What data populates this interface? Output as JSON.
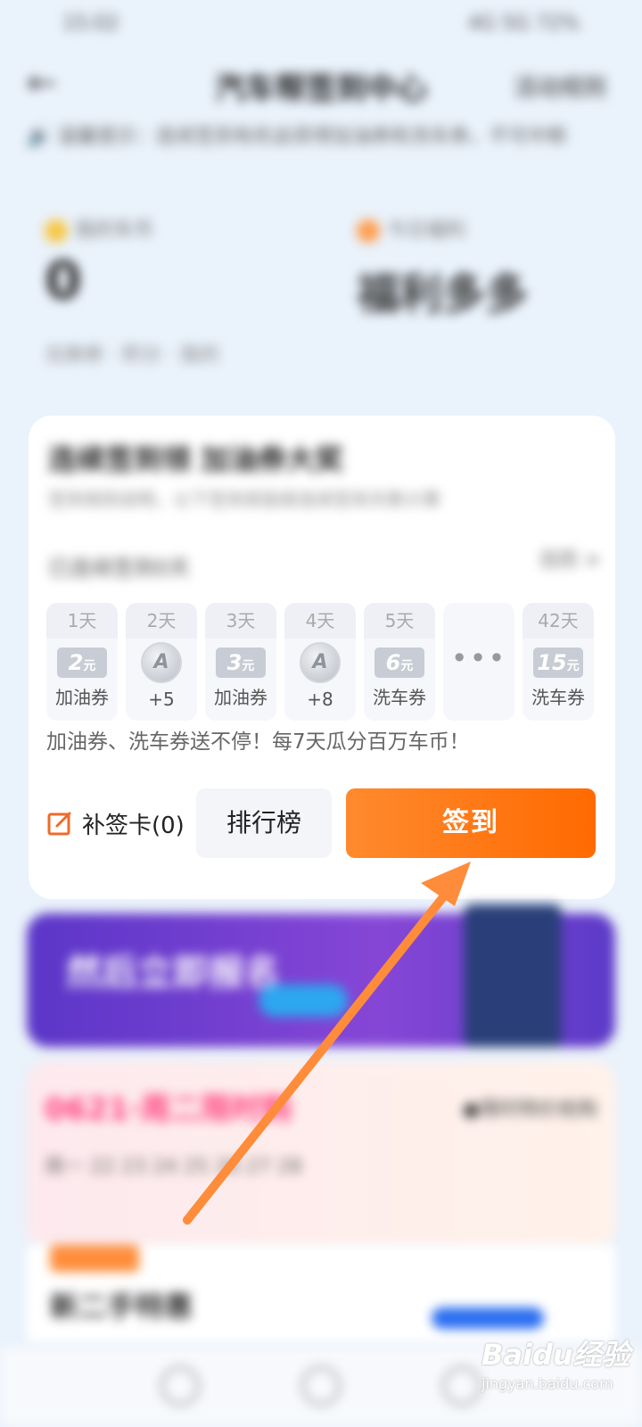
{
  "status_bar": {
    "time": "15:02",
    "right": "4G 5G 72%"
  },
  "header": {
    "title": "汽车帮签到中心",
    "right_label": "活动规则"
  },
  "notice": {
    "text": "温馨提示：连续签到有机会获得加油券和洗车券，不可中断"
  },
  "stats": {
    "coins_label": "我的车币",
    "coins_value": "0",
    "plan_label": "今日福利",
    "plan_value": "福利多多",
    "crumbs": "兑换券  ·  积分  ·  我的"
  },
  "card": {
    "blur_title": "连续签到领 加油券大奖",
    "blur_sub": "签到规则说明，以下签到奖励按连续签到天数计算",
    "streak_text": "已连续签到0天",
    "more_link": "日历 >",
    "days": [
      {
        "day": "1天",
        "ticket": "2",
        "unit": "元",
        "label": "加油券",
        "kind": "ticket"
      },
      {
        "day": "2天",
        "coin": "A",
        "label": "+5",
        "kind": "coin"
      },
      {
        "day": "3天",
        "ticket": "3",
        "unit": "元",
        "label": "加油券",
        "kind": "ticket"
      },
      {
        "day": "4天",
        "coin": "A",
        "label": "+8",
        "kind": "coin"
      },
      {
        "day": "5天",
        "ticket": "6",
        "unit": "元",
        "label": "洗车券",
        "kind": "ticket"
      },
      {
        "day": "",
        "dots": "•••",
        "kind": "dots"
      },
      {
        "day": "42天",
        "ticket": "15",
        "unit": "元",
        "label": "洗车券",
        "kind": "ticket"
      }
    ],
    "promo": "加油券、洗车券送不停！每7天瓜分百万车币！",
    "makeup_label": "补签卡(0)",
    "rank_label": "排行榜",
    "signin_label": "签到"
  },
  "banner": {
    "title": "然后立即报名"
  },
  "sale": {
    "title": "0621·周二限时购",
    "right": "●限时特价抢购",
    "dates": "周一  22  23  24  25  26  27  28"
  },
  "feed": {
    "title": "新二手特惠"
  },
  "watermark": {
    "brand": "Baidu经验",
    "url": "jingyan.baidu.com"
  },
  "colors": {
    "accent": "#ff6a00",
    "arrow": "#ff8c3a"
  }
}
